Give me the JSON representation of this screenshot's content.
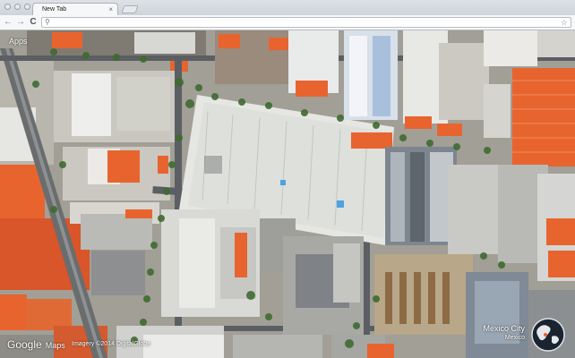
{
  "browser": {
    "tab_title": "New Tab",
    "tab_close": "×",
    "back": "←",
    "forward": "→",
    "reload": "C",
    "omnibox_value": "",
    "omnibox_icon": "search-icon",
    "star_icon": "star-icon"
  },
  "newtab": {
    "apps_label": "Apps",
    "brand_google": "Google",
    "brand_maps": "Maps",
    "credits": "Imagery ©2014 DigitalGlobe",
    "location_city": "Mexico City",
    "location_country": "Mexico"
  },
  "colors": {
    "roof_orange": "#e8642f",
    "roof_white": "#e9ecef",
    "roof_gray": "#8a9199",
    "vegetation": "#3f6b32",
    "road": "#5b5f63"
  }
}
